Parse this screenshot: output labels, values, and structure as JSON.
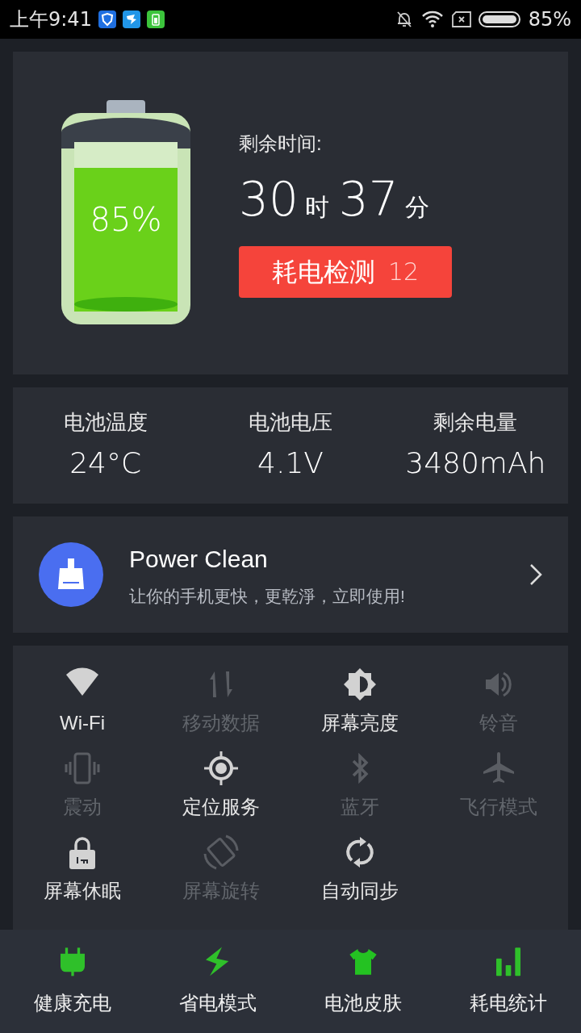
{
  "status_bar": {
    "time": "上午9:41",
    "battery_text": "85%"
  },
  "battery": {
    "percent": "85%",
    "remaining_label": "剩余时间:",
    "hours": "30",
    "hours_unit": "时",
    "minutes": "37",
    "minutes_unit": "分",
    "check_button": "耗电检测",
    "check_count": "12"
  },
  "stats": [
    {
      "label": "电池温度",
      "value": "24°C"
    },
    {
      "label": "电池电压",
      "value": "4.1V"
    },
    {
      "label": "剩余电量",
      "value": "3480mAh"
    }
  ],
  "promo": {
    "title": "Power Clean",
    "subtitle": "让你的手机更快，更乾淨，立即使用!"
  },
  "toggles": [
    {
      "kind": "wifi",
      "label": "Wi-Fi",
      "on": true
    },
    {
      "kind": "data",
      "label": "移动数据",
      "on": false
    },
    {
      "kind": "brightness",
      "label": "屏幕亮度",
      "on": true
    },
    {
      "kind": "ringer",
      "label": "铃音",
      "on": false
    },
    {
      "kind": "vibrate",
      "label": "震动",
      "on": false
    },
    {
      "kind": "location",
      "label": "定位服务",
      "on": true
    },
    {
      "kind": "bluetooth",
      "label": "蓝牙",
      "on": false
    },
    {
      "kind": "airplane",
      "label": "飞行模式",
      "on": false
    },
    {
      "kind": "lock",
      "label": "屏幕休眠",
      "on": true
    },
    {
      "kind": "rotate",
      "label": "屏幕旋转",
      "on": false
    },
    {
      "kind": "sync",
      "label": "自动同步",
      "on": true
    }
  ],
  "bottom_nav": [
    {
      "kind": "plug",
      "label": "健康充电"
    },
    {
      "kind": "bolt",
      "label": "省电模式"
    },
    {
      "kind": "shirt",
      "label": "电池皮肤"
    },
    {
      "kind": "bars",
      "label": "耗电统计"
    }
  ]
}
